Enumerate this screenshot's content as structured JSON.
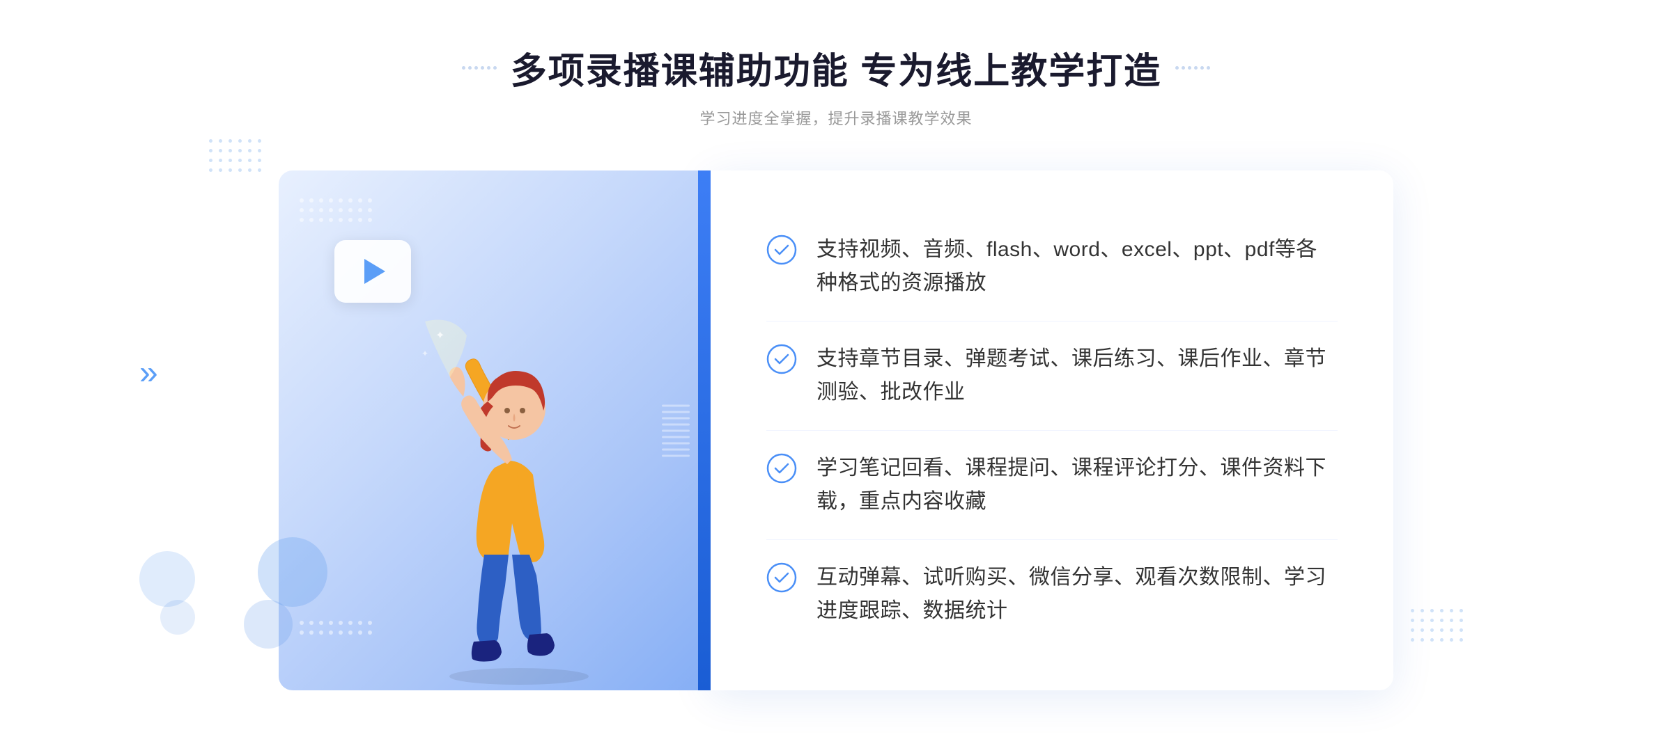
{
  "header": {
    "title": "多项录播课辅助功能 专为线上教学打造",
    "subtitle": "学习进度全掌握，提升录播课教学效果"
  },
  "features": [
    {
      "id": 1,
      "text": "支持视频、音频、flash、word、excel、ppt、pdf等各种格式的资源播放"
    },
    {
      "id": 2,
      "text": "支持章节目录、弹题考试、课后练习、课后作业、章节测验、批改作业"
    },
    {
      "id": 3,
      "text": "学习笔记回看、课程提问、课程评论打分、课件资料下载，重点内容收藏"
    },
    {
      "id": 4,
      "text": "互动弹幕、试听购买、微信分享、观看次数限制、学习进度跟踪、数据统计"
    }
  ],
  "icons": {
    "check": "check-circle-icon",
    "play": "play-icon",
    "chevron": "chevron-icon"
  },
  "colors": {
    "accent": "#3d7ef5",
    "accent_light": "#7ab3f8",
    "title_color": "#1a1a2e",
    "text_color": "#333333",
    "subtitle_color": "#999999"
  }
}
